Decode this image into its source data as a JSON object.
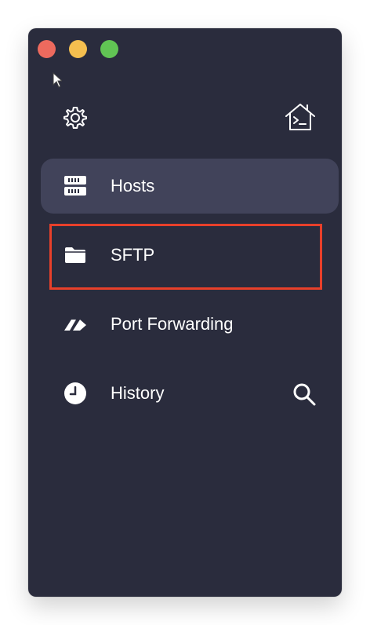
{
  "window": {
    "controls": [
      "close",
      "minimize",
      "zoom"
    ]
  },
  "toolbar": {
    "settings_icon": "gear-icon",
    "terminal_home_icon": "terminal-home-icon"
  },
  "nav": {
    "items": [
      {
        "label": "Hosts",
        "icon": "server-icon",
        "active": true
      },
      {
        "label": "SFTP",
        "icon": "folder-icon",
        "active": false,
        "highlighted": true
      },
      {
        "label": "Port Forwarding",
        "icon": "port-forwarding-icon",
        "active": false
      },
      {
        "label": "History",
        "icon": "clock-icon",
        "active": false
      }
    ],
    "history_action_icon": "search-icon"
  },
  "colors": {
    "sidebar_bg": "#2a2c3d",
    "active_item_bg": "#41435a",
    "highlight_border": "#e8402a",
    "text": "#ffffff"
  }
}
